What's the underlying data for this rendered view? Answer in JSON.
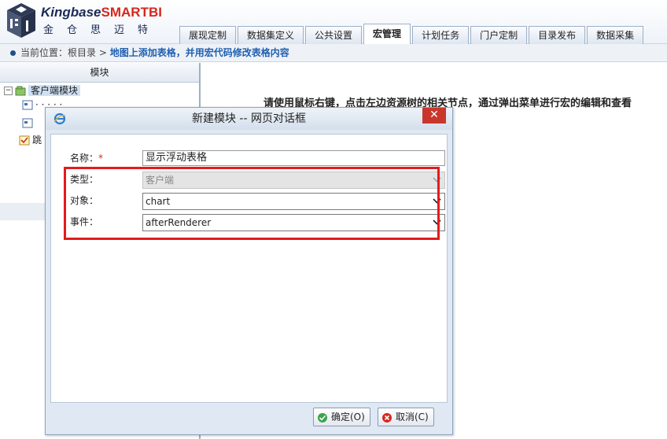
{
  "header": {
    "brand_main": "Kingbase",
    "brand_smart": "SMARTBI",
    "brand_sub": "金仓思迈特",
    "tabs": [
      {
        "label": "展现定制",
        "active": false
      },
      {
        "label": "数据集定义",
        "active": false
      },
      {
        "label": "公共设置",
        "active": false
      },
      {
        "label": "宏管理",
        "active": true
      },
      {
        "label": "计划任务",
        "active": false
      },
      {
        "label": "门户定制",
        "active": false
      },
      {
        "label": "目录发布",
        "active": false
      },
      {
        "label": "数据采集",
        "active": false
      }
    ]
  },
  "breadcrumb": {
    "prefix": "当前位置：",
    "root": "根目录 >",
    "current": "地图上添加表格，并用宏代码修改表格内容"
  },
  "leftpane": {
    "header": "模块",
    "tree": {
      "root_label": "客户端模块",
      "child1_label": "· · · · ·",
      "node3_label": "跳"
    }
  },
  "main": {
    "info": "请使用鼠标右键，点击左边资源树的相关节点，通过弹出菜单进行宏的编辑和查看"
  },
  "dialog": {
    "title": "新建模块 -- 网页对话框",
    "close": "✕",
    "fields": {
      "name_label": "名称：",
      "required_mark": "*",
      "name_value": "显示浮动表格",
      "type_label": "类型：",
      "type_value": "客户端",
      "object_label": "对象：",
      "object_value": "chart",
      "event_label": "事件：",
      "event_value": "afterRenderer"
    },
    "ok_label": "确定(O)",
    "cancel_label": "取消(C)"
  },
  "colors": {
    "highlight_border": "#e31b1b",
    "close_button": "#c9372c",
    "brand_red": "#d8261c",
    "brand_navy": "#1b2a55"
  }
}
